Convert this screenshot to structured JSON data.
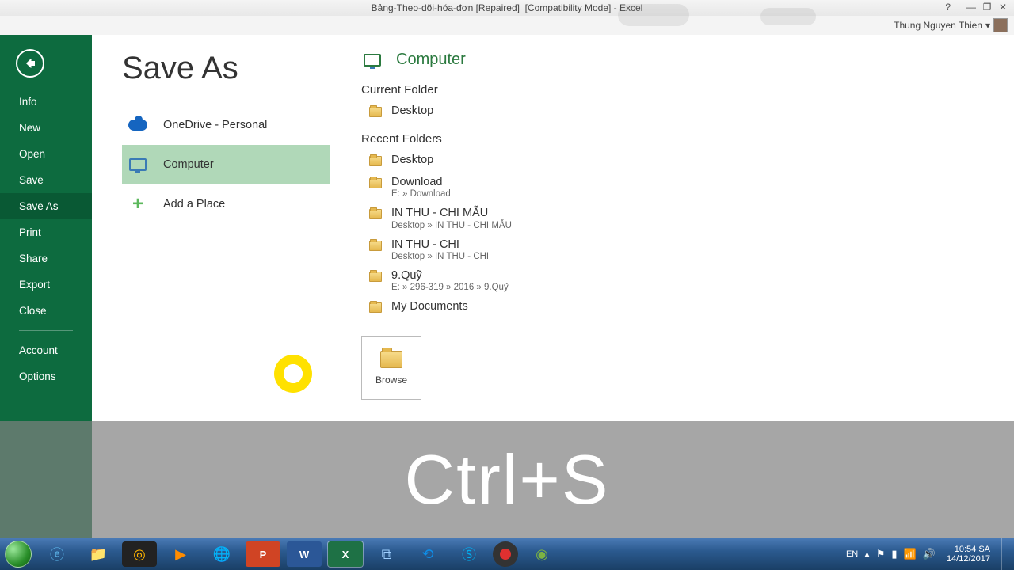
{
  "titlebar": {
    "title": "Bảng-Theo-dõi-hóa-đơn [Repaired]  [Compatibility Mode] - Excel"
  },
  "user": {
    "name": "Thung Nguyen Thien"
  },
  "sidebar": {
    "items": [
      "Info",
      "New",
      "Open",
      "Save",
      "Save As",
      "Print",
      "Share",
      "Export",
      "Close"
    ],
    "bottom": [
      "Account",
      "Options"
    ]
  },
  "page": {
    "title": "Save As"
  },
  "places": {
    "onedrive": "OneDrive - Personal",
    "computer": "Computer",
    "addplace": "Add a Place"
  },
  "location": {
    "header": "Computer",
    "current_section": "Current Folder",
    "current": {
      "name": "Desktop"
    },
    "recent_section": "Recent Folders",
    "recent": [
      {
        "name": "Desktop",
        "path": ""
      },
      {
        "name": "Download",
        "path": "E: » Download"
      },
      {
        "name": "IN THU - CHI  MẪU",
        "path": "Desktop » IN THU - CHI  MẪU"
      },
      {
        "name": "IN THU - CHI",
        "path": "Desktop » IN THU - CHI"
      },
      {
        "name": "9.Quỹ",
        "path": "E: » 296-319 » 2016 » 9.Quỹ"
      },
      {
        "name": "My Documents",
        "path": ""
      }
    ],
    "browse": "Browse"
  },
  "shortcut": "Ctrl+S",
  "tray": {
    "lang": "EN",
    "time": "10:54 SA",
    "date": "14/12/2017"
  }
}
